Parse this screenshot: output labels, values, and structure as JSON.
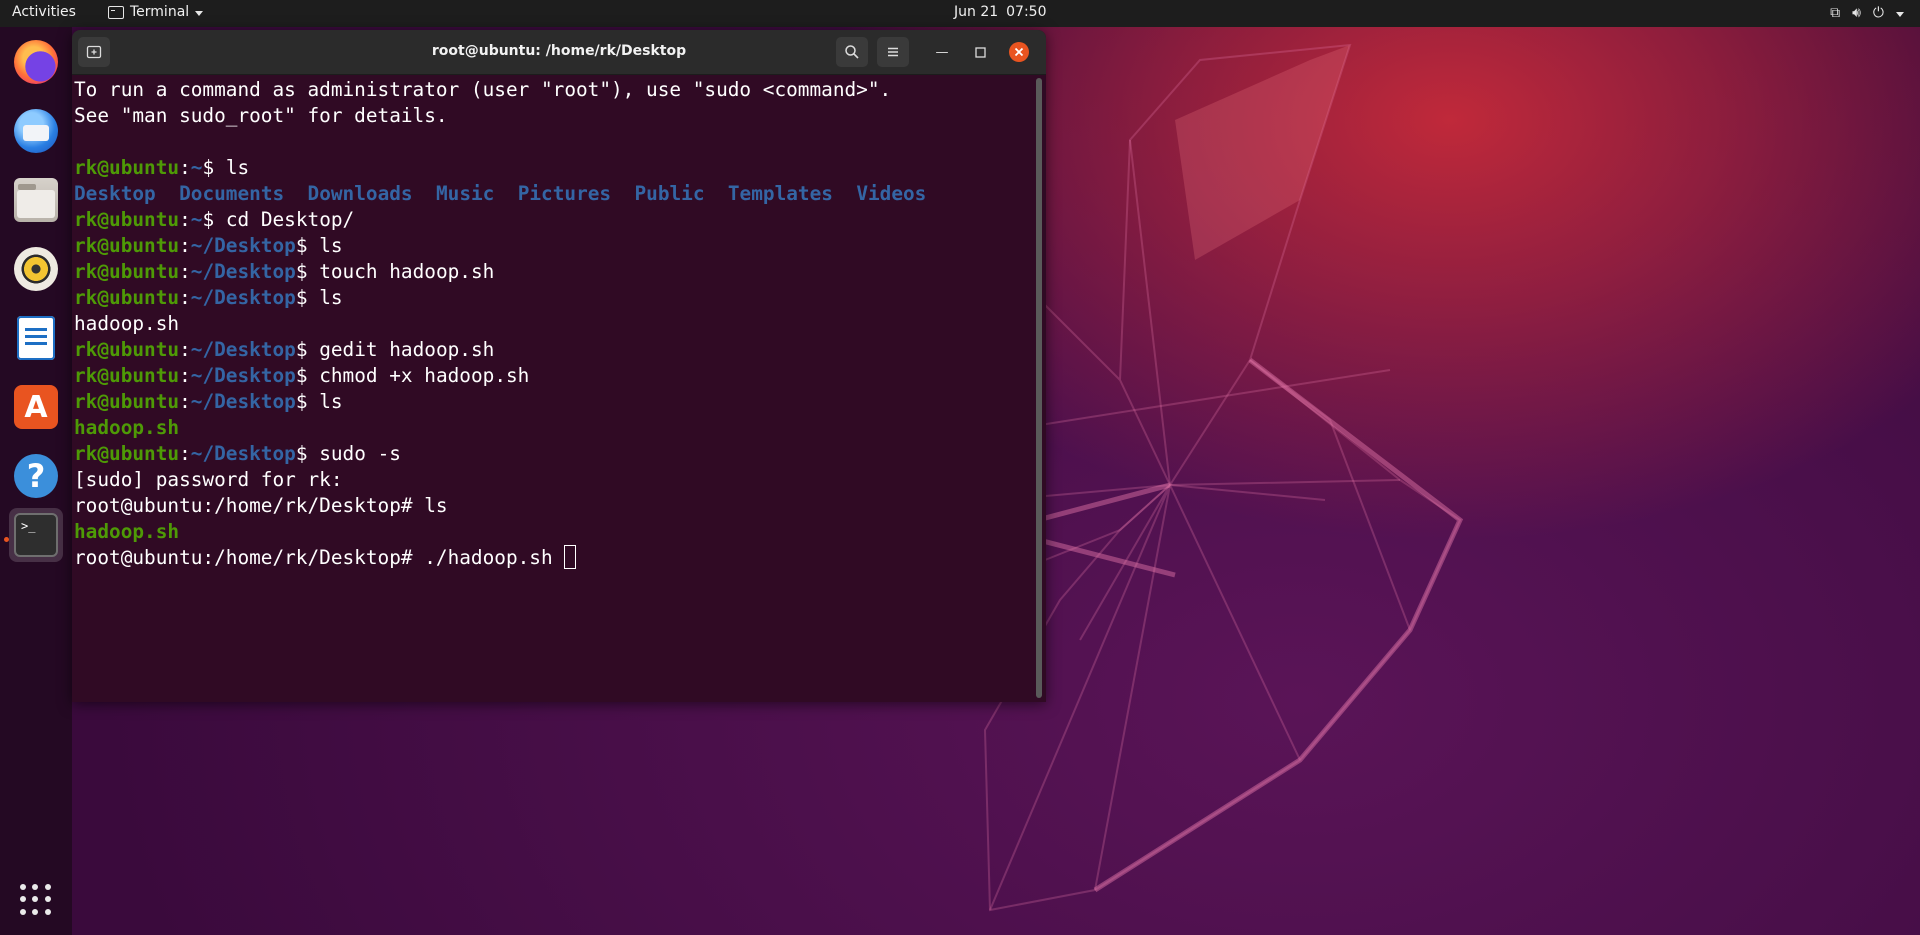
{
  "topbar": {
    "activities": "Activities",
    "app_name": "Terminal",
    "date": "Jun 21",
    "time": "07:50"
  },
  "dock": {
    "apps": [
      "Firefox",
      "Thunderbird",
      "Files",
      "Rhythmbox",
      "LibreOffice Writer",
      "Ubuntu Software",
      "Help",
      "Terminal"
    ],
    "active_app": "Terminal"
  },
  "window": {
    "title": "root@ubuntu: /home/rk/Desktop"
  },
  "terminal": {
    "intro1": "To run a command as administrator (user \"root\"), use \"sudo <command>\".",
    "intro2": "See \"man sudo_root\" for details.",
    "user": "rk@ubuntu",
    "sep": ":",
    "home": "~",
    "desktop_path": "~/Desktop",
    "prompt_end": "$ ",
    "cmd_ls": "ls",
    "cmd_cd": "cd Desktop/",
    "cmd_touch": "touch hadoop.sh",
    "cmd_gedit": "gedit hadoop.sh",
    "cmd_chmod": "chmod +x hadoop.sh",
    "cmd_sudo": "sudo -s",
    "dirs": [
      "Desktop",
      "Documents",
      "Downloads",
      "Music",
      "Pictures",
      "Public",
      "Templates",
      "Videos"
    ],
    "file": "hadoop.sh",
    "sudo_prompt": "[sudo] password for rk:",
    "root_prompt": "root@ubuntu:/home/rk/Desktop# ",
    "cmd_run": "./hadoop.sh "
  }
}
